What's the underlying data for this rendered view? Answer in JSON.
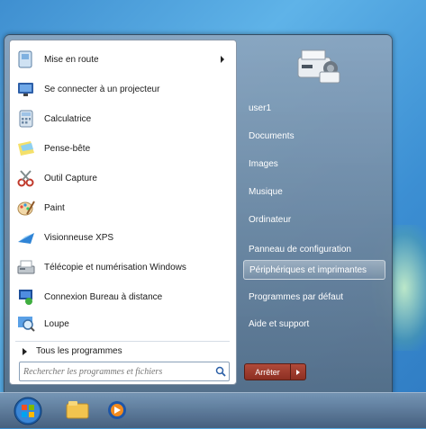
{
  "programs": [
    {
      "label": "Mise en route",
      "icon": "getting-started-icon",
      "has_submenu": true
    },
    {
      "label": "Se connecter à un projecteur",
      "icon": "projector-icon",
      "has_submenu": false
    },
    {
      "label": "Calculatrice",
      "icon": "calculator-icon",
      "has_submenu": false
    },
    {
      "label": "Pense-bête",
      "icon": "sticky-notes-icon",
      "has_submenu": false
    },
    {
      "label": "Outil Capture",
      "icon": "snipping-tool-icon",
      "has_submenu": false
    },
    {
      "label": "Paint",
      "icon": "paint-icon",
      "has_submenu": false
    },
    {
      "label": "Visionneuse XPS",
      "icon": "xps-viewer-icon",
      "has_submenu": false
    },
    {
      "label": "Télécopie et numérisation Windows",
      "icon": "fax-scan-icon",
      "has_submenu": false
    },
    {
      "label": "Connexion Bureau à distance",
      "icon": "remote-desktop-icon",
      "has_submenu": false
    },
    {
      "label": "Loupe",
      "icon": "magnifier-icon",
      "has_submenu": false
    }
  ],
  "all_programs_label": "Tous les programmes",
  "search_placeholder": "Rechercher les programmes et fichiers",
  "right_items": [
    {
      "label": "user1"
    },
    {
      "label": "Documents"
    },
    {
      "label": "Images"
    },
    {
      "label": "Musique"
    },
    {
      "label": "Ordinateur"
    },
    {
      "label": "Panneau de configuration"
    },
    {
      "label": "Périphériques et imprimantes",
      "active": true
    },
    {
      "label": "Programmes par défaut"
    },
    {
      "label": "Aide et support"
    }
  ],
  "shutdown_label": "Arrêter",
  "taskbar_icons": [
    "start-orb-icon",
    "explorer-icon",
    "media-player-icon"
  ]
}
